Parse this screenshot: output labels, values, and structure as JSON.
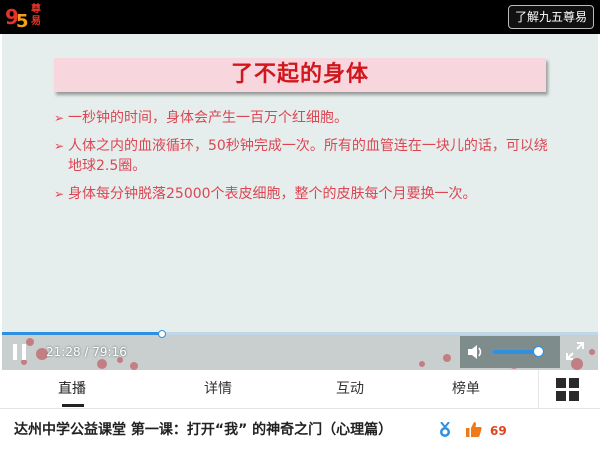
{
  "header": {
    "logo_text": "尊易",
    "about_label": "了解九五尊易"
  },
  "slide": {
    "title": "了不起的身体",
    "bullets": [
      "一秒钟的时间，身体会产生一百万个红细胞。",
      "人体之内的血液循环，50秒钟完成一次。所有的血管连在一块儿的话，可以绕地球2.5圈。",
      "身体每分钟脱落25000个表皮细胞，整个的皮肤每个月要换一次。"
    ],
    "bullet_marker": "➢"
  },
  "player": {
    "time": "21:28 / 79:16",
    "progress_fraction": 0.27,
    "volume_fraction": 0.9
  },
  "tabs": [
    {
      "label": "直播",
      "active": true
    },
    {
      "label": "详情",
      "active": false
    },
    {
      "label": "互动",
      "active": false
    },
    {
      "label": "榜单",
      "active": false
    }
  ],
  "footer": {
    "course_title": "达州中学公益课堂 第一课：打开“我” 的神奇之门（心理篇）",
    "like_count": "69"
  },
  "colors": {
    "accent_red": "#d1161c",
    "bullet_text": "#dc4653",
    "progress_blue": "#2f8fe0"
  }
}
